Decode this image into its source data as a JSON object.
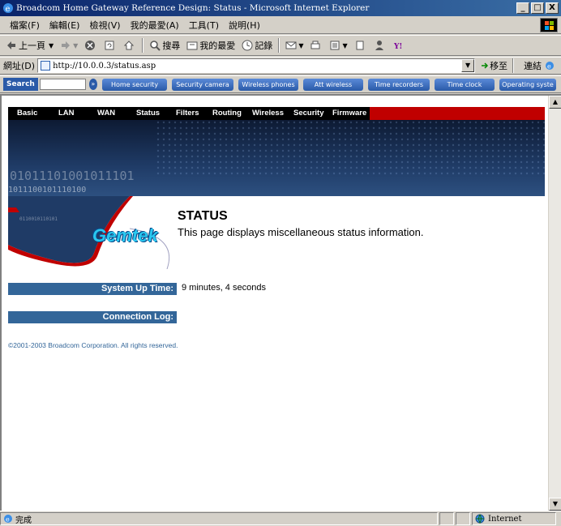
{
  "window": {
    "title": "Broadcom Home Gateway Reference Design: Status - Microsoft Internet Explorer",
    "minimize": "_",
    "maximize": "□",
    "close": "X"
  },
  "menu": [
    "檔案(F)",
    "編輯(E)",
    "檢視(V)",
    "我的最愛(A)",
    "工具(T)",
    "說明(H)"
  ],
  "toolbar": {
    "back": "上一頁",
    "search": "搜尋",
    "favorites": "我的最愛",
    "history": "記錄"
  },
  "address": {
    "label": "網址(D)",
    "url": "http://10.0.0.3/status.asp",
    "go": "移至",
    "links": "連結"
  },
  "search_toolbar": {
    "label": "Search",
    "buttons": [
      "Home security",
      "Security camera",
      "Wireless phones",
      "Att wireless",
      "Time recorders",
      "Time clock",
      "Operating syste"
    ]
  },
  "nav": [
    "Basic",
    "LAN",
    "WAN",
    "Status",
    "Filters",
    "Routing",
    "Wireless",
    "Security",
    "Firmware"
  ],
  "logo": "Gemtek",
  "page": {
    "title": "STATUS",
    "description": "This page displays miscellaneous status information."
  },
  "status": {
    "uptime_label": "System Up Time:",
    "uptime_value": "9 minutes, 4 seconds",
    "log_label": "Connection Log:"
  },
  "copyright": "©2001-2003 Broadcom Corporation. All rights reserved.",
  "statusbar": {
    "text": "完成",
    "zone": "Internet"
  }
}
